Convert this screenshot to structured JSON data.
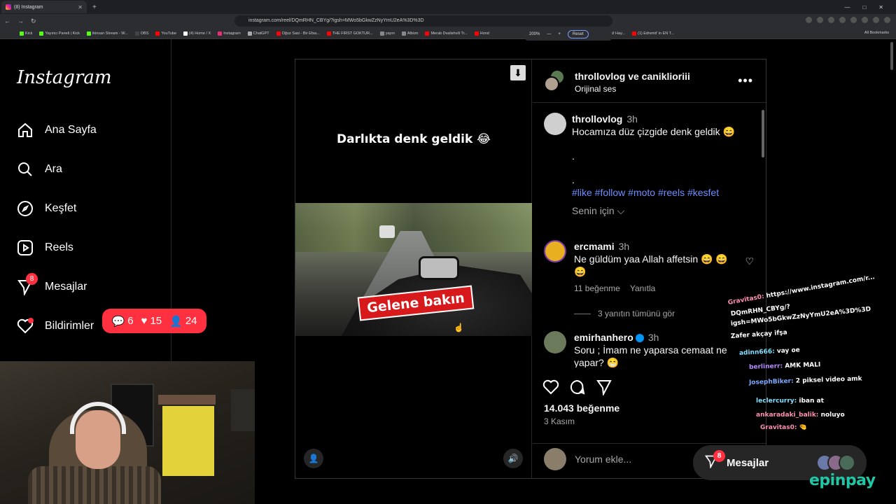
{
  "browser": {
    "tab_title": "(8) Instagram",
    "url": "instagram.com/reel/DQmRHN_CBYg/?igsh=MWo5bGkwZzNyYmU2eA%3D%3D",
    "zoom_level": "200%",
    "zoom_reset_label": "Reset",
    "bookmarks": [
      "Kick",
      "Yayıncı Paneli | Kick",
      "ikinsan Stream - W...",
      "OBS",
      "YouTube",
      "(4) Home / X",
      "Instagram",
      "ChatGPT",
      "Oğuz Sasi - Bir Efsa...",
      "THE FIRST GOKTUR...",
      "yayın",
      "Albüm",
      "Merab Dvalishvili Tr...",
      "Hond",
      "Kişiye Özel Evcil Hay...",
      "(1) Edremit' in EN T..."
    ],
    "all_bookmarks_label": "All Bookmarks"
  },
  "sidebar": {
    "logo": "Instagram",
    "items": [
      {
        "label": "Ana Sayfa",
        "icon": "home-icon"
      },
      {
        "label": "Ara",
        "icon": "search-icon"
      },
      {
        "label": "Keşfet",
        "icon": "compass-icon"
      },
      {
        "label": "Reels",
        "icon": "reels-icon"
      },
      {
        "label": "Mesajlar",
        "icon": "messenger-icon",
        "badge": "8"
      },
      {
        "label": "Bildirimler",
        "icon": "heart-icon"
      }
    ],
    "notif_pill": {
      "comments": "6",
      "likes": "15",
      "follows": "24"
    }
  },
  "post": {
    "overlay_caption": "Darlıkta denk geldik 😂",
    "stamp_text": "Gelene bakın",
    "header_names": "throllovlog ve caniklioriii",
    "header_sub": "Orijinal ses",
    "caption": {
      "user": "throllovlog",
      "time": "3h",
      "text": "Hocamıza düz çizgide denk geldik 😄",
      "dots": [
        ".",
        "."
      ],
      "hashtags": "#like #follow #moto #reels #kesfet"
    },
    "for_you": "Senin için ⌵",
    "comments": [
      {
        "user": "ercmami",
        "time": "3h",
        "text": "Ne güldüm yaa Allah affetsin 😄 😄 😄",
        "likes": "11 beğenme",
        "reply": "Yanıtla",
        "view_replies": "3 yanıtın tümünü gör"
      },
      {
        "user": "emirhanhero",
        "time": "3h",
        "text": "Soru ; İmam ne yaparsa cemaat ne yapar? 😁"
      }
    ],
    "likes_count": "14.043 beğenme",
    "date": "3 Kasım",
    "add_comment_placeholder": "Yorum ekle..."
  },
  "chat": [
    {
      "name": "Gravitas0:",
      "msg": "https://www.instagram.com/r..."
    },
    {
      "name": "",
      "msg": "DQmRHN_CBYg/?"
    },
    {
      "name": "",
      "msg": "igsh=MWo5bGkwZzNyYmU2eA%3D%3D"
    },
    {
      "name": "",
      "msg": "Zafer akçay ifşa"
    },
    {
      "name": "adinn666:",
      "msg": "vay oe"
    },
    {
      "name": "berlinerr:",
      "msg": "AMK MALI"
    },
    {
      "name": "JosephBiker:",
      "msg": "2 piksel video amk"
    },
    {
      "name": "leclercurry:",
      "msg": "iban at"
    },
    {
      "name": "ankaradaki_balik:",
      "msg": "noluyo"
    },
    {
      "name": "Gravitas0:",
      "msg": "🤏"
    }
  ],
  "msg_pill": {
    "label": "Mesajlar",
    "badge": "8"
  },
  "brand": "epinpay",
  "colors": {
    "accent_red": "#ff3040",
    "link_blue": "#6d8dff",
    "verified": "#0095f6",
    "epinpay": "#1fc7a6"
  }
}
